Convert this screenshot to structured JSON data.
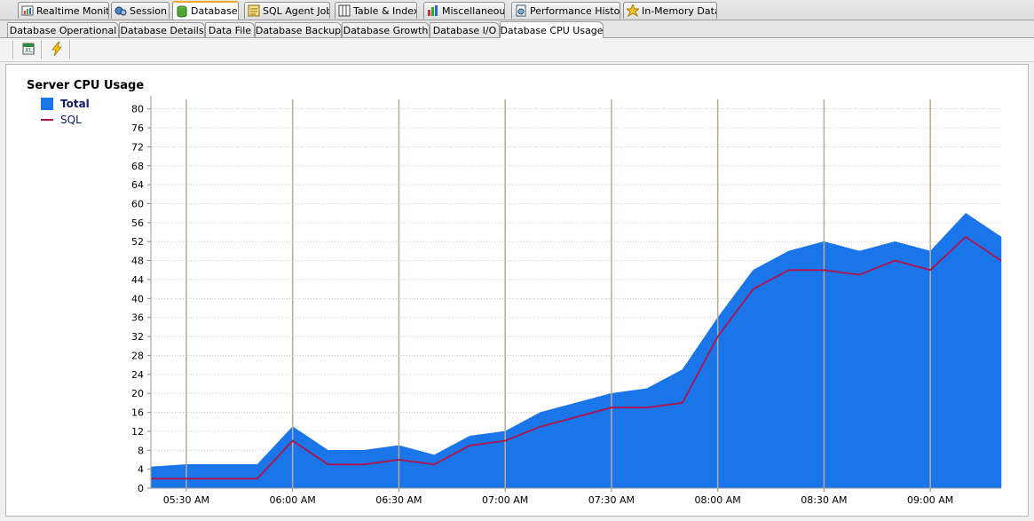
{
  "main_tabs": [
    {
      "label": "Realtime Monitor",
      "icon": "realtime-monitor-icon",
      "active": false
    },
    {
      "label": "Session",
      "icon": "session-icon",
      "active": false
    },
    {
      "label": "Database",
      "icon": "database-icon",
      "active": true
    },
    {
      "label": "SQL Agent Job",
      "icon": "sql-agent-job-icon",
      "active": false
    },
    {
      "label": "Table & Index",
      "icon": "table-index-icon",
      "active": false
    },
    {
      "label": "Miscellaneous",
      "icon": "miscellaneous-icon",
      "active": false
    },
    {
      "label": "Performance History",
      "icon": "performance-history-icon",
      "active": false
    },
    {
      "label": "In-Memory Data",
      "icon": "in-memory-data-icon",
      "active": false
    }
  ],
  "sub_tabs": [
    {
      "label": "Database Operational",
      "active": false
    },
    {
      "label": "Database Details",
      "active": false
    },
    {
      "label": "Data File",
      "active": false
    },
    {
      "label": "Database Backup",
      "active": false
    },
    {
      "label": "Database Growth",
      "active": false
    },
    {
      "label": "Database I/O",
      "active": false
    },
    {
      "label": "Database CPU Usage",
      "active": true
    }
  ],
  "toolbar": {
    "buttons": [
      {
        "icon": "excel-export-icon"
      },
      {
        "icon": "lightning-icon"
      }
    ]
  },
  "chart_data": {
    "type": "area",
    "title": "Server CPU Usage",
    "legend_placement": "top-left",
    "ylim": [
      0,
      82
    ],
    "yticks": [
      0,
      4,
      8,
      12,
      16,
      20,
      24,
      28,
      32,
      36,
      40,
      44,
      48,
      52,
      56,
      60,
      64,
      68,
      72,
      76,
      80
    ],
    "xlim": [
      "05:20 AM",
      "09:20 AM"
    ],
    "xticks": [
      "05:30 AM",
      "06:00 AM",
      "06:30 AM",
      "07:00 AM",
      "07:30 AM",
      "08:00 AM",
      "08:30 AM",
      "09:00 AM"
    ],
    "grid": {
      "horizontal": "dotted",
      "vertical": "solid at ticks"
    },
    "x": [
      "05:20",
      "05:30",
      "05:40",
      "05:50",
      "06:00",
      "06:10",
      "06:20",
      "06:30",
      "06:40",
      "06:50",
      "07:00",
      "07:10",
      "07:20",
      "07:30",
      "07:40",
      "07:50",
      "08:00",
      "08:10",
      "08:20",
      "08:30",
      "08:40",
      "08:50",
      "09:00",
      "09:10",
      "09:20"
    ],
    "series": [
      {
        "name": "Total",
        "color": "#1a75e8",
        "style": "area",
        "values": [
          4.5,
          5,
          5,
          5,
          13,
          8,
          8,
          9,
          7,
          11,
          12,
          16,
          18,
          20,
          21,
          25,
          36,
          46,
          50,
          52,
          50,
          52,
          50,
          58,
          53
        ]
      },
      {
        "name": "SQL",
        "color": "#b0124a",
        "style": "line",
        "values": [
          2,
          2,
          2,
          2,
          10,
          5,
          5,
          6,
          5,
          9,
          10,
          13,
          15,
          17,
          17,
          18,
          32,
          42,
          46,
          46,
          45,
          48,
          46,
          53,
          48
        ]
      }
    ]
  },
  "colors": {
    "area_fill": "#1a75e8",
    "sql_line": "#b0124a",
    "active_tab_accent": "#f5a623",
    "legend_text": "#111a60"
  }
}
